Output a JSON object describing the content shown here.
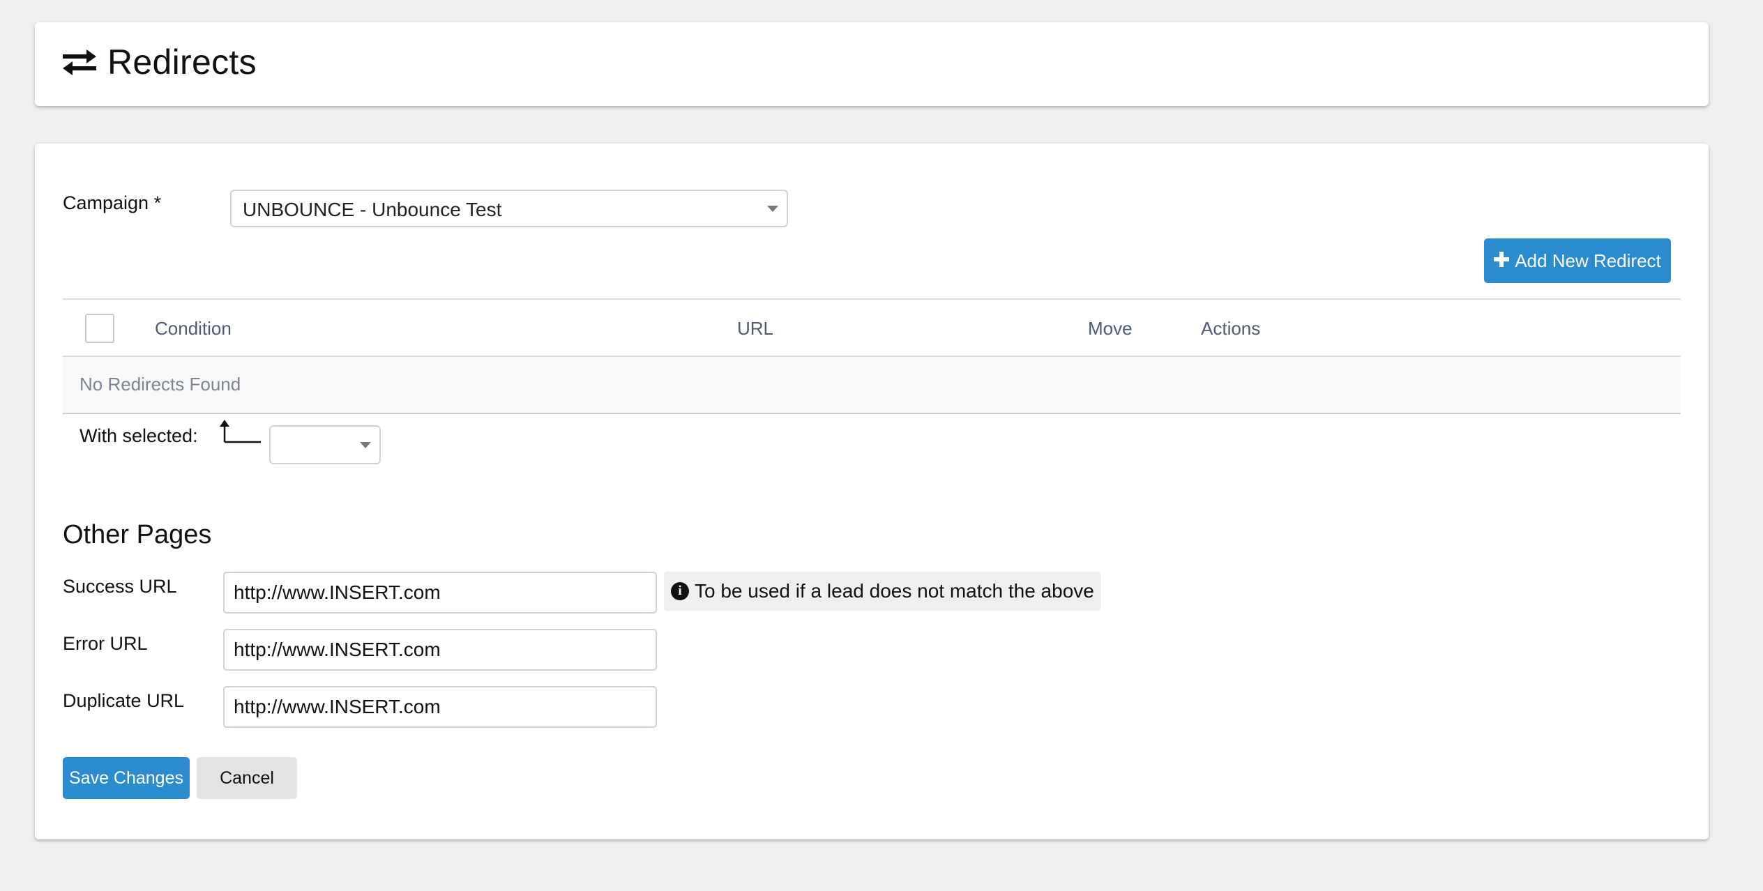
{
  "header": {
    "title": "Redirects",
    "icon": "exchange-arrows-icon"
  },
  "campaign": {
    "label": "Campaign *",
    "selected": "UNBOUNCE - Unbounce Test"
  },
  "add_redirect": {
    "icon": "plus-icon",
    "label": "Add New Redirect"
  },
  "table": {
    "columns": [
      "Condition",
      "URL",
      "Move",
      "Actions"
    ],
    "empty_message": "No Redirects Found"
  },
  "bulk": {
    "label": "With selected:",
    "icon": "corner-up-arrow-icon",
    "selected": ""
  },
  "other_pages": {
    "title": "Other Pages",
    "success": {
      "label": "Success URL",
      "value": "http://www.INSERT.com"
    },
    "error": {
      "label": "Error URL",
      "value": "http://www.INSERT.com"
    },
    "duplicate": {
      "label": "Duplicate URL",
      "value": "http://www.INSERT.com"
    },
    "hint": {
      "icon": "info-circle-icon",
      "text": "To be used if a lead does not match the above"
    }
  },
  "actions": {
    "save": "Save Changes",
    "cancel": "Cancel"
  },
  "colors": {
    "primary": "#2a8bce",
    "header_text": "#4c5b71",
    "background": "#efefef"
  }
}
